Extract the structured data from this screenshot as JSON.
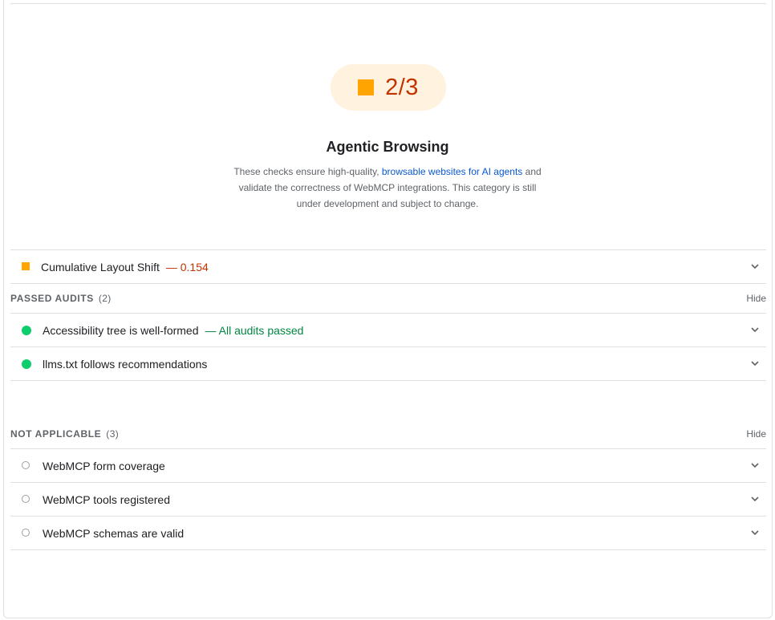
{
  "score": {
    "value": "2/3",
    "rating_color": "#ffa400",
    "text_color": "#c33300",
    "background_color": "#fff3e0"
  },
  "category": {
    "title": "Agentic Browsing",
    "description_before": "These checks ensure high-quality, ",
    "description_link": "browsable websites for AI agents",
    "description_after": " and validate the correctness of WebMCP integrations. This category is still under development and subject to change."
  },
  "failing_audits": [
    {
      "title": "Cumulative Layout Shift",
      "display_value": "— 0.154",
      "icon": "average-square-icon",
      "expand_icon": "chevron-down-icon"
    }
  ],
  "passed_group": {
    "title": "Passed audits",
    "count": "(2)",
    "toggle_label": "Hide",
    "audits": [
      {
        "title": "Accessibility tree is well-formed",
        "display_value": "— All audits passed",
        "icon": "pass-circle-icon",
        "expand_icon": "chevron-down-icon"
      },
      {
        "title": "llms.txt follows recommendations",
        "display_value": "",
        "icon": "pass-circle-icon",
        "expand_icon": "chevron-down-icon"
      }
    ]
  },
  "not_applicable_group": {
    "title": "Not applicable",
    "count": "(3)",
    "toggle_label": "Hide",
    "audits": [
      {
        "title": "WebMCP form coverage",
        "icon": "not-applicable-circle-icon",
        "expand_icon": "chevron-down-icon"
      },
      {
        "title": "WebMCP tools registered",
        "icon": "not-applicable-circle-icon",
        "expand_icon": "chevron-down-icon"
      },
      {
        "title": "WebMCP schemas are valid",
        "icon": "not-applicable-circle-icon",
        "expand_icon": "chevron-down-icon"
      }
    ]
  },
  "colors": {
    "pass": "#0cce6b",
    "pass_text": "#018642",
    "average": "#ffa400",
    "average_text": "#c33300",
    "link": "#0b57d0",
    "divider": "#e0e0e0"
  }
}
